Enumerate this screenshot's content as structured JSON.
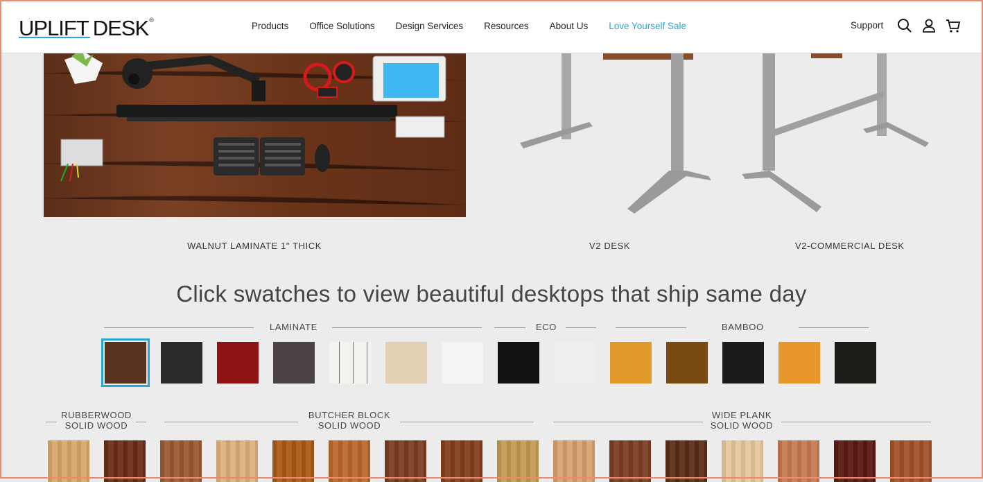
{
  "header": {
    "logo_word1": "UPLIFT",
    "logo_word2": "DESK",
    "logo_reg": "®",
    "nav": [
      "Products",
      "Office Solutions",
      "Design Services",
      "Resources",
      "About Us",
      "Love Yourself Sale"
    ],
    "support": "Support",
    "icons": [
      "search-icon",
      "account-icon",
      "cart-icon"
    ],
    "accent": "#2aa6d6"
  },
  "hero": {
    "captions": [
      "WALNUT LAMINATE 1\" THICK",
      "V2 DESK",
      "V2-COMMERCIAL DESK"
    ]
  },
  "swatch_title": "Click swatches to view beautiful desktops that ship same day",
  "groups_row1": {
    "laminate": "LAMINATE",
    "eco": "ECO",
    "bamboo": "BAMBOO"
  },
  "groups_row2": {
    "rubberwood_1": "RUBBERWOOD",
    "rubberwood_2": "SOLID WOOD",
    "butcher_1": "BUTCHER BLOCK",
    "butcher_2": "SOLID WOOD",
    "wide_1": "WIDE PLANK",
    "wide_2": "SOLID WOOD"
  },
  "swatches_row1": [
    {
      "color": "#5a3220",
      "selected": true
    },
    {
      "color": "#2b2b2e"
    },
    {
      "color": "#8c1414"
    },
    {
      "color": "#4a4242"
    },
    {
      "color": "#f4f2ee",
      "note": true
    },
    {
      "color": "#e3cfb4"
    },
    {
      "color": "#f4f4f4"
    },
    {
      "color": "#111111"
    },
    {
      "color": "#efefef"
    },
    {
      "color": "#e29a2a"
    },
    {
      "color": "#7a4a14"
    },
    {
      "color": "#1a1a18"
    },
    {
      "color": "#e7972c"
    },
    {
      "color": "#1c1c18"
    }
  ],
  "swatches_row2": [
    "#d9a86a",
    "#6b2e18",
    "#9a5b33",
    "#deb07c",
    "#a85a16",
    "#b96a2e",
    "#7a3e22",
    "#84401c",
    "#c69a52",
    "#d9a070",
    "#7c3f24",
    "#5c2e16",
    "#e8c89c",
    "#c67c52",
    "#5a1a12",
    "#a2522a"
  ]
}
